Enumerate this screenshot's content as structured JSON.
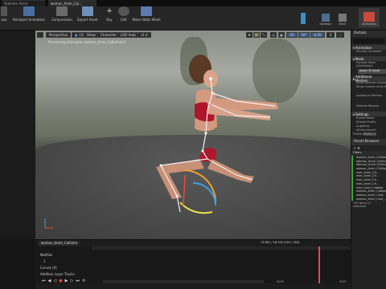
{
  "window": {
    "tabs": [
      "Skeleton Asset",
      "woman_Anim_Cal..."
    ]
  },
  "toolbar": {
    "left_cut_label": "ave",
    "buttons": [
      "Reimport Animation",
      "Compression",
      "Export Asset",
      "Key",
      "Edit",
      "Make Static Mesh"
    ],
    "modes": [
      "Skeleton",
      "Mesh",
      "Animation"
    ]
  },
  "viewport": {
    "buttons": [
      "Perspective",
      "Lit",
      "Show",
      "Character",
      "LOD Auto",
      "x1.0"
    ],
    "right_controls": [
      "10",
      "10°",
      "0.25",
      "4"
    ],
    "preview_text": "Previewing Animation woman_Anim_Callistretch",
    "accent_color": "#f0a030"
  },
  "details": {
    "tab": "Details",
    "animation_section": "Animation",
    "animation_props": [
      "Preview Controller"
    ],
    "mesh_section": "Mesh",
    "mesh_props": [
      "Preview Mesh (Animation)"
    ],
    "apply_label": "Apply To Asset",
    "additional_section": "Additional Meshes",
    "additional_props": [
      "Allow Different Skeletons",
      "Allow Custom Anim BP",
      "Additional Meshes",
      "Skeletal Meshes"
    ],
    "settings_section": "Settings",
    "settings_props": [
      "Profile Name",
      "Shared Profile"
    ],
    "lighting_label": "Lighting",
    "environment_label": "Environment",
    "profile_label": "Profile",
    "profile_value": "Profile_0",
    "asset_browser_label": "Asset Browser",
    "filters_label": "Filters",
    "asset_rows": [
      "woman_Anim_Callistretch",
      "Woman_Anim_Chilling",
      "Woman_Anim_Chilling2",
      "woman_Anim_Chilling3",
      "man_Anim_Ch...",
      "man_Anim_Ch...",
      "man_Anim_Ch...",
      "man_Anim_Ch...",
      "man_Anim_Cobbler",
      "woman_Anim_Cobbler",
      "woman_Anim_Coils",
      "woman_Anim_Core_..."
    ],
    "items_count": "130 items (1 selected)"
  },
  "timeline": {
    "tab_label": "woman_Anim_Callistre",
    "rows": [
      "Notifies",
      "1",
      "Curves (0)",
      "Additive Layer Tracks"
    ],
    "frame_readout": "13.601 / 18.100 (001 / 183)",
    "time_right": "0009",
    "time_far": "0007"
  }
}
